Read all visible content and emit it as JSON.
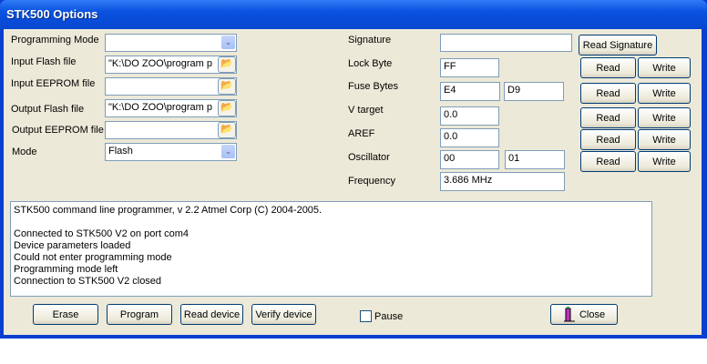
{
  "window": {
    "title": "STK500 Options"
  },
  "left": {
    "programming_mode": {
      "label": "Programming Mode",
      "value": ""
    },
    "input_flash": {
      "label": "Input Flash file",
      "value": "\"K:\\DO ZOO\\program p"
    },
    "input_eeprom": {
      "label": "Input EEPROM file",
      "value": ""
    },
    "output_flash": {
      "label": "Output Flash file",
      "value": "\"K:\\DO ZOO\\program p"
    },
    "output_eeprom": {
      "label": "Output EEPROM file",
      "value": ""
    },
    "mode": {
      "label": "Mode",
      "value": "Flash"
    }
  },
  "right": {
    "signature": {
      "label": "Signature",
      "value": "",
      "button": "Read Signature"
    },
    "lock_byte": {
      "label": "Lock Byte",
      "value": "FF"
    },
    "fuse_bytes": {
      "label": "Fuse Bytes",
      "value1": "E4",
      "value2": "D9"
    },
    "v_target": {
      "label": "V target",
      "value": "0.0"
    },
    "aref": {
      "label": "AREF",
      "value": "0.0"
    },
    "oscillator": {
      "label": "Oscillator",
      "value1": "00",
      "value2": "01"
    },
    "frequency": {
      "label": "Frequency",
      "value": "3.686 MHz"
    },
    "read_label": "Read",
    "write_label": "Write"
  },
  "log": [
    "STK500 command line programmer, v 2.2 Atmel Corp (C) 2004-2005.",
    "",
    "Connected to STK500 V2 on port com4",
    "Device parameters loaded",
    "Could not enter programming mode",
    "Programming mode left",
    "Connection to STK500 V2 closed"
  ],
  "buttons": {
    "erase": "Erase",
    "program": "Program",
    "read_device": "Read device",
    "verify_device": "Verify device",
    "pause": "Pause",
    "pause_checked": false,
    "close": "Close"
  }
}
